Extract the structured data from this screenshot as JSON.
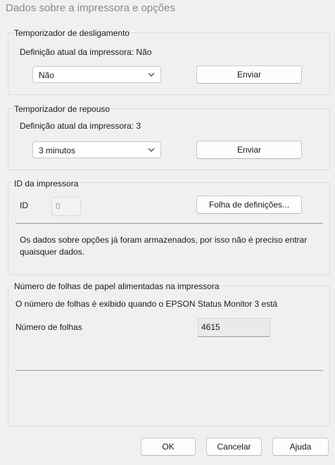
{
  "window": {
    "title": "Dados sobre a impressora e opções"
  },
  "power_off_timer": {
    "legend": "Temporizador de desligamento",
    "current_setting": "Definição atual da impressora: Não",
    "selected_value": "Não",
    "send_label": "Enviar"
  },
  "sleep_timer": {
    "legend": "Temporizador de repouso",
    "current_setting": "Definição atual da impressora: 3",
    "selected_value": "3 minutos",
    "send_label": "Enviar"
  },
  "printer_id": {
    "legend": "ID da impressora",
    "id_label": "ID",
    "id_value": "0",
    "settings_sheet_label": "Folha de definições...",
    "info_text": "Os dados sobre opções já foram armazenados, por isso não é preciso entrar quaisquer dados."
  },
  "sheet_count": {
    "legend": "Número de folhas de papel alimentadas na impressora",
    "info_text": "O número de folhas é exibido quando o EPSON Status Monitor 3 está",
    "count_label": "Número de folhas",
    "count_value": "4615"
  },
  "footer": {
    "ok_label": "OK",
    "cancel_label": "Cancelar",
    "help_label": "Ajuda"
  },
  "icons": {
    "dropdown": "chevron-down-icon"
  }
}
